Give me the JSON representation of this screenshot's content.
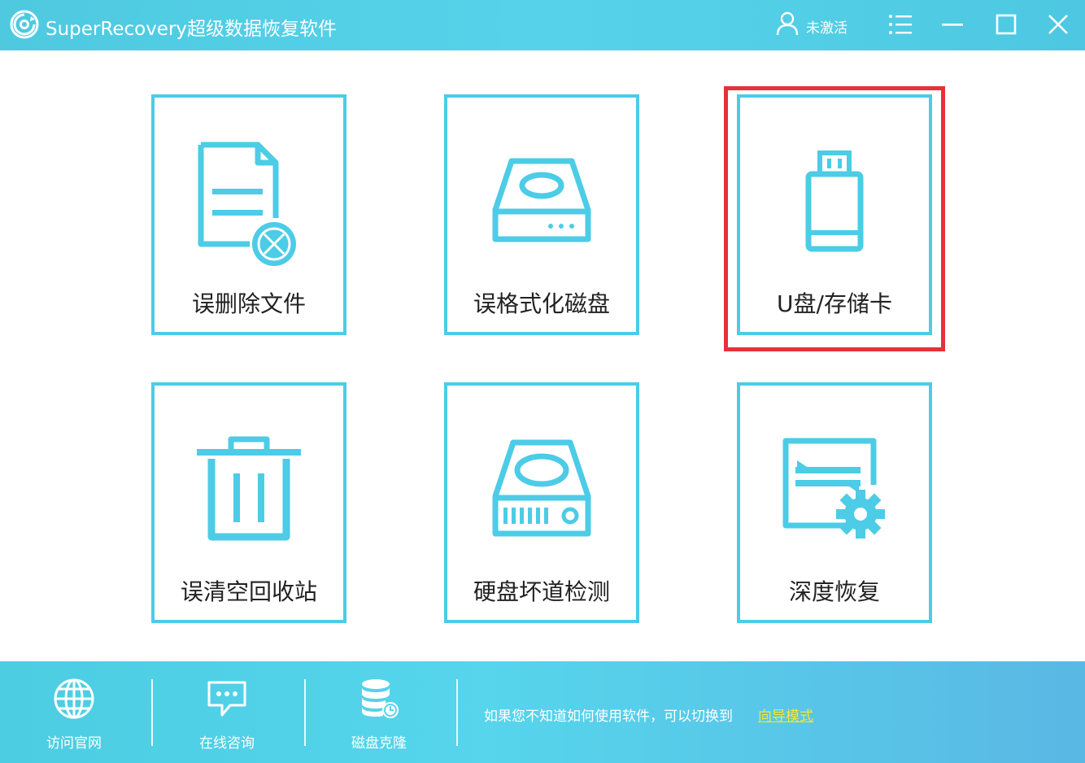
{
  "window": {
    "title": "SuperRecovery超级数据恢复软件",
    "user_status": "未激活",
    "icons": {
      "logo": "app-logo-icon",
      "user": "user-icon",
      "menu": "menu-list-icon",
      "minimize": "minimize-icon",
      "maximize": "maximize-icon",
      "close": "close-icon"
    }
  },
  "tiles": [
    {
      "label": "误删除文件",
      "icon": "deleted-file-icon"
    },
    {
      "label": "误格式化磁盘",
      "icon": "formatted-disk-icon"
    },
    {
      "label": "U盘/存储卡",
      "icon": "usb-drive-icon",
      "highlighted": true
    },
    {
      "label": "误清空回收站",
      "icon": "recycle-bin-icon"
    },
    {
      "label": "硬盘坏道检测",
      "icon": "hard-disk-check-icon"
    },
    {
      "label": "深度恢复",
      "icon": "deep-recovery-icon"
    }
  ],
  "footer": {
    "buttons": [
      {
        "label": "访问官网",
        "icon": "globe-icon"
      },
      {
        "label": "在线咨询",
        "icon": "chat-icon"
      },
      {
        "label": "磁盘克隆",
        "icon": "disk-clone-icon"
      }
    ],
    "hint": "如果您不知道如何使用软件，可以切换到",
    "guide_link": "向导模式"
  },
  "colors": {
    "accent": "#4ccce6",
    "highlight": "#e8303a",
    "link": "#f7e433"
  }
}
